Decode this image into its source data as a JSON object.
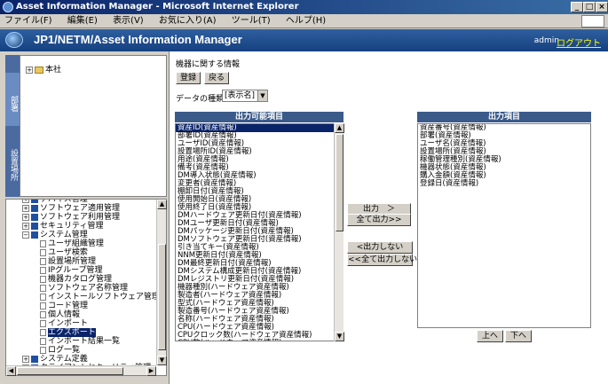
{
  "window": {
    "title": "Asset Information Manager - Microsoft Internet Explorer",
    "min": "_",
    "max": "□",
    "close": "×"
  },
  "menu": [
    "ファイル(F)",
    "編集(E)",
    "表示(V)",
    "お気に入り(A)",
    "ツール(T)",
    "ヘルプ(H)"
  ],
  "app": {
    "title": "JP1/NETM/Asset Information Manager",
    "user": "admin",
    "logout": "ログアウト"
  },
  "nav_tabs": [
    "部署",
    "設置場所"
  ],
  "top_tree": {
    "root": "本社"
  },
  "tree": [
    {
      "label": "デバイス管理",
      "indent": 1,
      "kind": "book",
      "exp": "+"
    },
    {
      "label": "ソフトウェア適用管理",
      "indent": 1,
      "kind": "book",
      "exp": "+"
    },
    {
      "label": "ソフトウェア利用管理",
      "indent": 1,
      "kind": "book",
      "exp": "+"
    },
    {
      "label": "セキュリティ管理",
      "indent": 1,
      "kind": "book",
      "exp": "+"
    },
    {
      "label": "システム管理",
      "indent": 1,
      "kind": "book",
      "exp": "−"
    },
    {
      "label": "ユーザ組織管理",
      "indent": 2,
      "kind": "page"
    },
    {
      "label": "ユーザ検索",
      "indent": 2,
      "kind": "page"
    },
    {
      "label": "設置場所管理",
      "indent": 2,
      "kind": "page"
    },
    {
      "label": "IPグループ管理",
      "indent": 2,
      "kind": "page"
    },
    {
      "label": "機器カタログ管理",
      "indent": 2,
      "kind": "page"
    },
    {
      "label": "ソフトウェア名称管理",
      "indent": 2,
      "kind": "page"
    },
    {
      "label": "インストールソフトウェア管理",
      "indent": 2,
      "kind": "page"
    },
    {
      "label": "コード管理",
      "indent": 2,
      "kind": "page"
    },
    {
      "label": "個人情報",
      "indent": 2,
      "kind": "page"
    },
    {
      "label": "インポート",
      "indent": 2,
      "kind": "page"
    },
    {
      "label": "エクスポート",
      "indent": 2,
      "kind": "page",
      "selected": true
    },
    {
      "label": "インポート結果一覧",
      "indent": 2,
      "kind": "page"
    },
    {
      "label": "ログ一覧",
      "indent": 2,
      "kind": "page"
    },
    {
      "label": "システム定義",
      "indent": 1,
      "kind": "book",
      "exp": "+"
    },
    {
      "label": "クライアントセキュリティ管理",
      "indent": 1,
      "kind": "book",
      "exp": "+"
    }
  ],
  "main": {
    "heading": "機器に関する情報",
    "register": "登録",
    "back": "戻る",
    "data_type_label": "データの種類",
    "data_type_value": "[表示名]",
    "available_header": "出力可能項目",
    "output_header": "出力項目",
    "btn_output": "出力　＞",
    "btn_output_all": "全て出力>>",
    "btn_remove": "<出力しない",
    "btn_remove_all": "<<全て出力しない",
    "btn_up": "上へ",
    "btn_down": "下へ"
  },
  "available_items": [
    "資産ID(資産情報)",
    "部署ID(資産情報)",
    "ユーザID(資産情報)",
    "設置場所ID(資産情報)",
    "用途(資産情報)",
    "備考(資産情報)",
    "DM導入状態(資産情報)",
    "変更者(資産情報)",
    "棚卸日付(資産情報)",
    "使用開始日(資産情報)",
    "使用終了日(資産情報)",
    "DMハードウェア更新日付(資産情報)",
    "DMユーザ更新日付(資産情報)",
    "DMパッケージ更新日付(資産情報)",
    "DMソフトウェア更新日付(資産情報)",
    "引き当てキー(資産情報)",
    "NNM更新日付(資産情報)",
    "DM最終更新日付(資産情報)",
    "DMシステム構成更新日付(資産情報)",
    "DMレジストリ更新日付(資産情報)",
    "機器種別(ハードウェア資産情報)",
    "製造者(ハードウェア資産情報)",
    "型式(ハードウェア資産情報)",
    "製造番号(ハードウェア資産情報)",
    "名称(ハードウェア資産情報)",
    "CPU(ハードウェア資産情報)",
    "CPUクロック数(ハードウェア資産情報)",
    "CPU数(ハードウェア資産情報)"
  ],
  "output_items": [
    "資産番号(資産情報)",
    "部署(資産情報)",
    "ユーザ名(資産情報)",
    "設置場所(資産情報)",
    "稼働管理種別(資産情報)",
    "機器状態(資産情報)",
    "購入金額(資産情報)",
    "登録日(資産情報)"
  ]
}
